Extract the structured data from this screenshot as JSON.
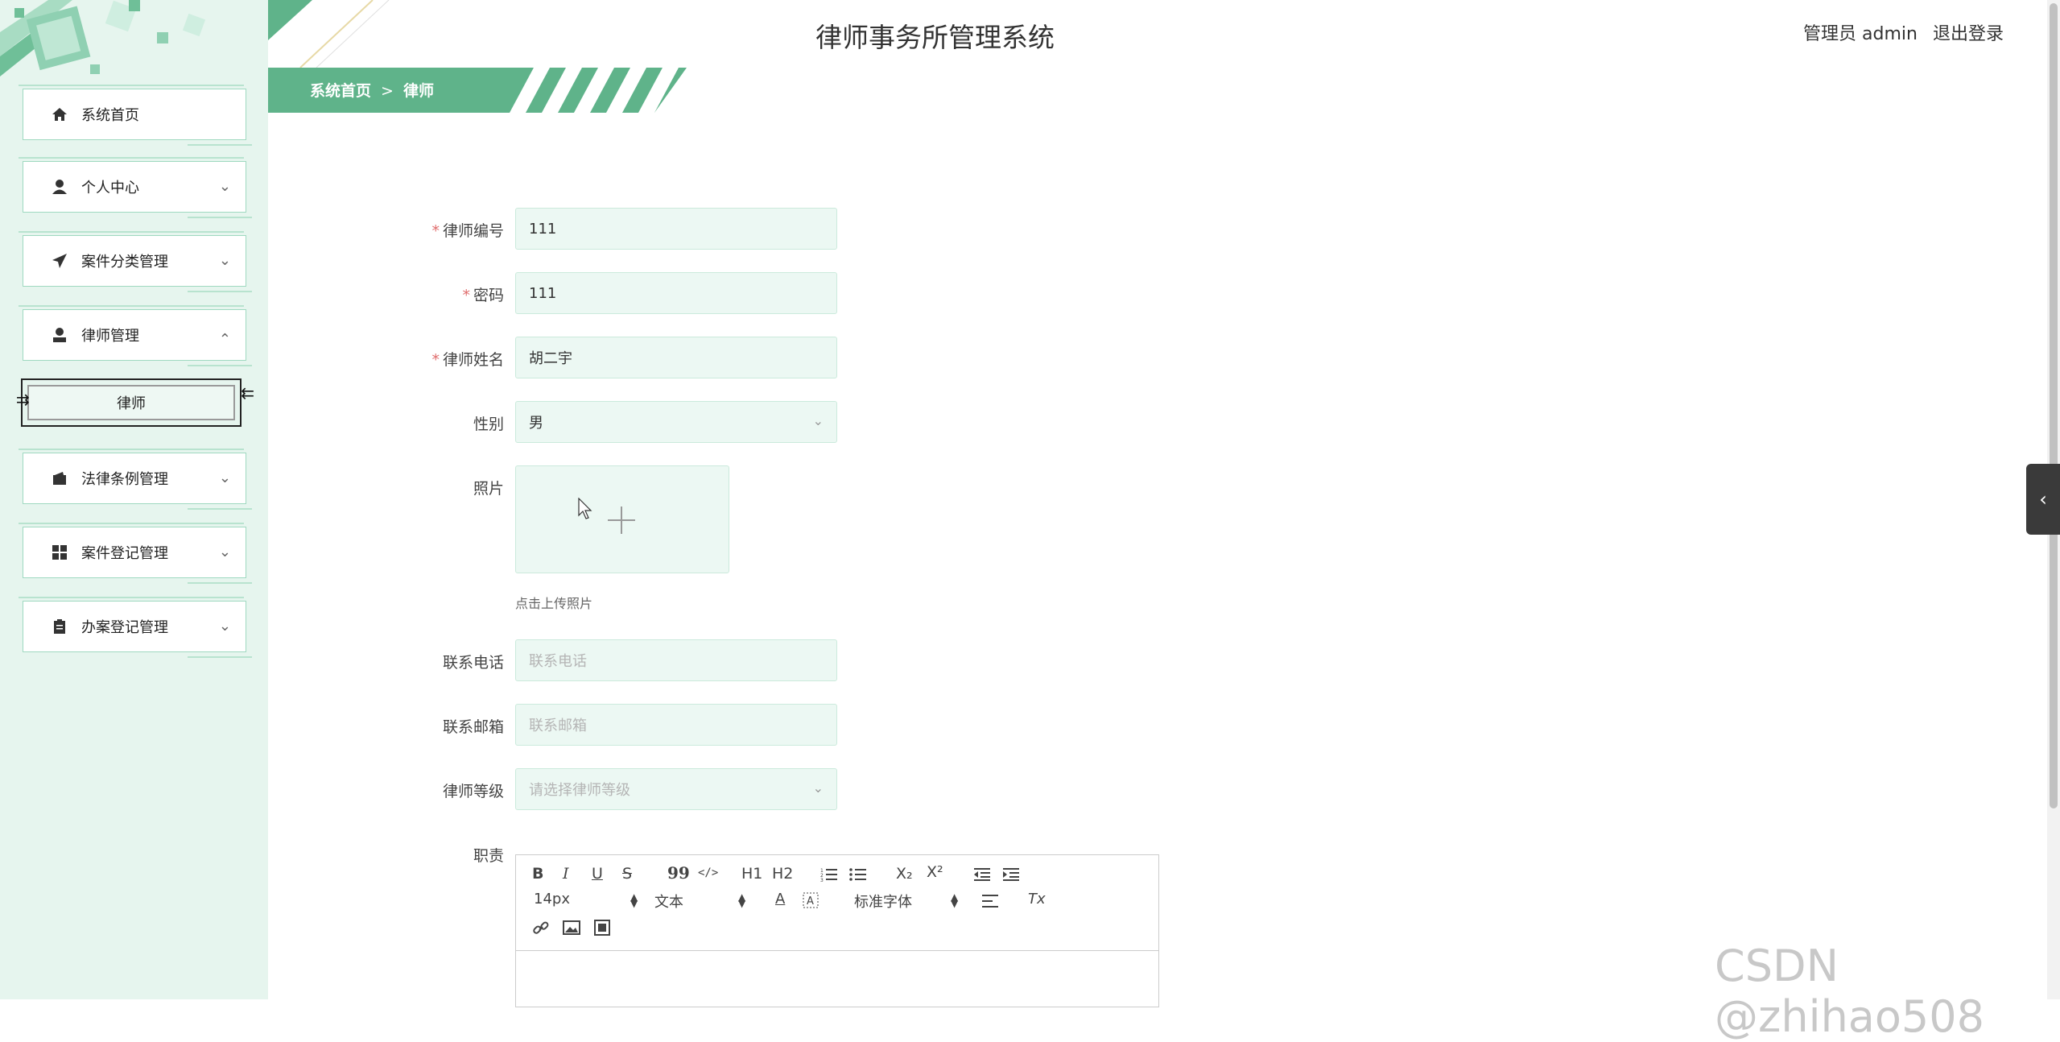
{
  "header": {
    "title": "律师事务所管理系统",
    "user_label": "管理员 admin",
    "logout": "退出登录"
  },
  "breadcrumb": {
    "home": "系统首页",
    "separator": ">",
    "current": "律师"
  },
  "sidebar": {
    "items": [
      {
        "label": "系统首页",
        "icon": "home-icon"
      },
      {
        "label": "个人中心",
        "icon": "user-icon"
      },
      {
        "label": "案件分类管理",
        "icon": "paper-plane-icon"
      },
      {
        "label": "律师管理",
        "icon": "user-tie-icon",
        "expanded": true
      },
      {
        "label": "法律条例管理",
        "icon": "wallet-icon"
      },
      {
        "label": "案件登记管理",
        "icon": "grid-icon"
      },
      {
        "label": "办案登记管理",
        "icon": "clipboard-icon"
      }
    ],
    "submenu": {
      "label": "律师"
    }
  },
  "form": {
    "lawyer_no": {
      "label": "律师编号",
      "value": "111",
      "required": true
    },
    "password": {
      "label": "密码",
      "value": "111",
      "required": true
    },
    "lawyer_name": {
      "label": "律师姓名",
      "value": "胡二宇",
      "required": true
    },
    "gender": {
      "label": "性别",
      "value": "男"
    },
    "photo": {
      "label": "照片",
      "hint": "点击上传照片"
    },
    "phone": {
      "label": "联系电话",
      "placeholder": "联系电话"
    },
    "email": {
      "label": "联系邮箱",
      "placeholder": "联系邮箱"
    },
    "level": {
      "label": "律师等级",
      "placeholder": "请选择律师等级"
    },
    "duty": {
      "label": "职责"
    }
  },
  "editor": {
    "font_size": "14px",
    "text_style": "文本",
    "font_family": "标准字体",
    "buttons": {
      "bold": "B",
      "italic": "I",
      "underline": "U",
      "strike": "S",
      "quote": "99",
      "code": "</>",
      "h1": "H1",
      "h2": "H2",
      "subscript": "X₂",
      "superscript": "X²",
      "font_color": "A",
      "clean": "Tx"
    }
  },
  "watermark": "CSDN @zhihao508",
  "colors": {
    "accent": "#5fb38a",
    "sidebar_bg": "#e6f5ee",
    "field_bg": "#ecf8f3",
    "required": "#e06c6c"
  }
}
